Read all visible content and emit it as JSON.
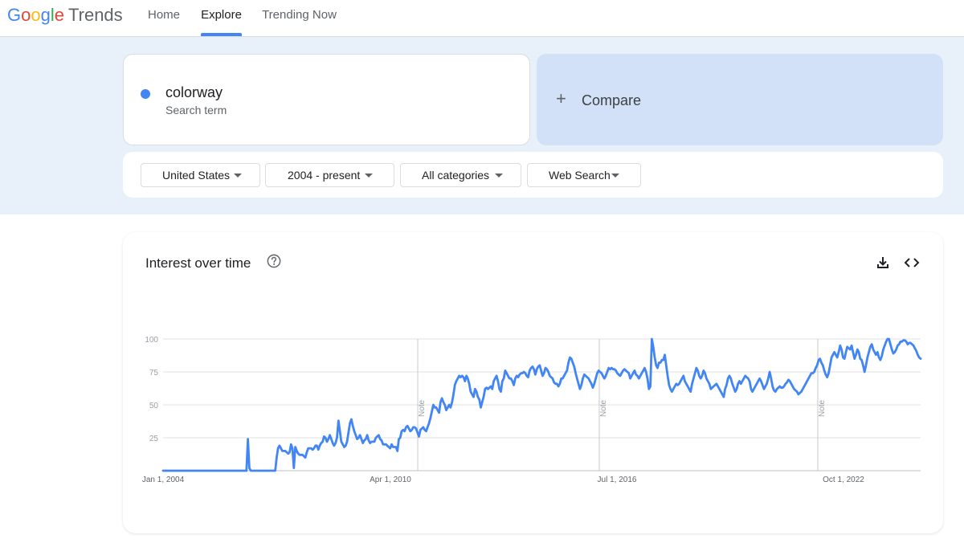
{
  "header": {
    "logo": {
      "g1": "G",
      "g2": "o",
      "g3": "o",
      "g4": "g",
      "g5": "l",
      "g6": "e",
      "product": "Trends"
    },
    "nav": [
      {
        "label": "Home"
      },
      {
        "label": "Explore",
        "active": true
      },
      {
        "label": "Trending Now"
      }
    ]
  },
  "search": {
    "term": {
      "name": "colorway",
      "sub": "Search term",
      "color": "#4285f4"
    },
    "compare": {
      "icon": "plus-icon",
      "label": "Compare"
    }
  },
  "filters": [
    {
      "label": "United States"
    },
    {
      "label": "2004 - present"
    },
    {
      "label": "All categories"
    },
    {
      "label": "Web Search"
    }
  ],
  "chart_card": {
    "title": "Interest over time",
    "icons": [
      "help-icon",
      "download-icon",
      "embed-icon"
    ]
  },
  "chart_data": {
    "type": "line",
    "series": [
      {
        "values": [
          0,
          0,
          0,
          0,
          0,
          0,
          0,
          0,
          0,
          0,
          0,
          0,
          0,
          0,
          0,
          0,
          0,
          0,
          0,
          0,
          0,
          0,
          0,
          0,
          0,
          0,
          0,
          0,
          0,
          0,
          0,
          0,
          0,
          0,
          0,
          0,
          0,
          0,
          0,
          0,
          0,
          0,
          0,
          0,
          0,
          0,
          0,
          0,
          0,
          0,
          0,
          0,
          0,
          0,
          0,
          0,
          0,
          0,
          0,
          24,
          2,
          0,
          0,
          0,
          0,
          0,
          0,
          0,
          0,
          0,
          0,
          0,
          0,
          0,
          0,
          0,
          0,
          0,
          0,
          10,
          17,
          19,
          17,
          15,
          15,
          15,
          14,
          13,
          14,
          20,
          17,
          2,
          18,
          15,
          13,
          12,
          12,
          12,
          11,
          10,
          14,
          17,
          17,
          17,
          16,
          17,
          19,
          19,
          16,
          19,
          21,
          22,
          26,
          25,
          22,
          24,
          27,
          24,
          21,
          19,
          21,
          25,
          38,
          30,
          22,
          20,
          18,
          19,
          22,
          29,
          36,
          39,
          34,
          30,
          27,
          24,
          25,
          27,
          24,
          21,
          23,
          24,
          27,
          23,
          21,
          22,
          22,
          22,
          25,
          26,
          27,
          24,
          23,
          20,
          20,
          20,
          19,
          18,
          17,
          20,
          18,
          18,
          18,
          15,
          24,
          25,
          30,
          31,
          30,
          33,
          34,
          32,
          30,
          31,
          33,
          33,
          32,
          29,
          26,
          31,
          32,
          33,
          31,
          30,
          33,
          36,
          40,
          45,
          50,
          48,
          48,
          46,
          44,
          52,
          55,
          52,
          50,
          46,
          48,
          50,
          48,
          52,
          58,
          65,
          68,
          70,
          72,
          71,
          72,
          71,
          68,
          72,
          70,
          66,
          60,
          58,
          56,
          62,
          60,
          56,
          54,
          48,
          52,
          56,
          62,
          63,
          62,
          63,
          64,
          62,
          68,
          70,
          72,
          68,
          62,
          60,
          68,
          70,
          76,
          74,
          72,
          70,
          70,
          68,
          65,
          70,
          72,
          71,
          73,
          74,
          74,
          75,
          74,
          72,
          71,
          76,
          78,
          79,
          77,
          73,
          77,
          79,
          80,
          76,
          72,
          74,
          78,
          77,
          75,
          72,
          71,
          70,
          67,
          66,
          66,
          64,
          66,
          70,
          70,
          72,
          74,
          76,
          82,
          86,
          85,
          82,
          79,
          74,
          70,
          66,
          62,
          65,
          70,
          73,
          72,
          71,
          70,
          68,
          66,
          63,
          66,
          70,
          74,
          76,
          75,
          74,
          72,
          70,
          72,
          75,
          78,
          77,
          78,
          77,
          77,
          76,
          74,
          73,
          72,
          74,
          76,
          77,
          76,
          75,
          74,
          70,
          72,
          74,
          76,
          73,
          72,
          70,
          72,
          74,
          76,
          78,
          75,
          70,
          62,
          64,
          100,
          94,
          86,
          80,
          78,
          82,
          82,
          84,
          84,
          88,
          80,
          72,
          65,
          62,
          60,
          62,
          64,
          66,
          65,
          66,
          68,
          70,
          72,
          68,
          66,
          64,
          62,
          60,
          66,
          70,
          74,
          78,
          76,
          72,
          70,
          72,
          76,
          74,
          70,
          68,
          66,
          62,
          63,
          64,
          65,
          66,
          64,
          62,
          60,
          58,
          56,
          62,
          65,
          70,
          72,
          70,
          66,
          63,
          60,
          62,
          66,
          68,
          66,
          68,
          70,
          72,
          71,
          70,
          68,
          62,
          60,
          62,
          64,
          66,
          68,
          70,
          68,
          65,
          62,
          64,
          66,
          70,
          75,
          70,
          64,
          61,
          60,
          62,
          63,
          64,
          63,
          63,
          64,
          66,
          67,
          69,
          68,
          66,
          64,
          62,
          61,
          60,
          58,
          59,
          60,
          62,
          64,
          66,
          68,
          70,
          72,
          74,
          74,
          75,
          78,
          80,
          84,
          85,
          82,
          80,
          76,
          73,
          71,
          74,
          80,
          86,
          88,
          90,
          88,
          86,
          90,
          95,
          92,
          86,
          85,
          90,
          94,
          93,
          92,
          95,
          90,
          85,
          88,
          92,
          90,
          85,
          84,
          80,
          75,
          80,
          86,
          90,
          94,
          96,
          92,
          90,
          88,
          90,
          86,
          84,
          87,
          92,
          95,
          98,
          100,
          100,
          96,
          92,
          89,
          90,
          92,
          95,
          96,
          98,
          98,
          99,
          99,
          98,
          96,
          97,
          97,
          96,
          95,
          93,
          91,
          88,
          86,
          85
        ]
      }
    ],
    "y_ticks": [
      "25",
      "50",
      "75",
      "100"
    ],
    "x_labels": [
      "Jan 1, 2004",
      "Apr 1, 2010",
      "Jul 1, 2016",
      "Oct 1, 2022"
    ],
    "notes": [
      "Note",
      "Note",
      "Note"
    ],
    "ylim": [
      0,
      100
    ],
    "grid": true,
    "line_color": "#4285f4"
  }
}
